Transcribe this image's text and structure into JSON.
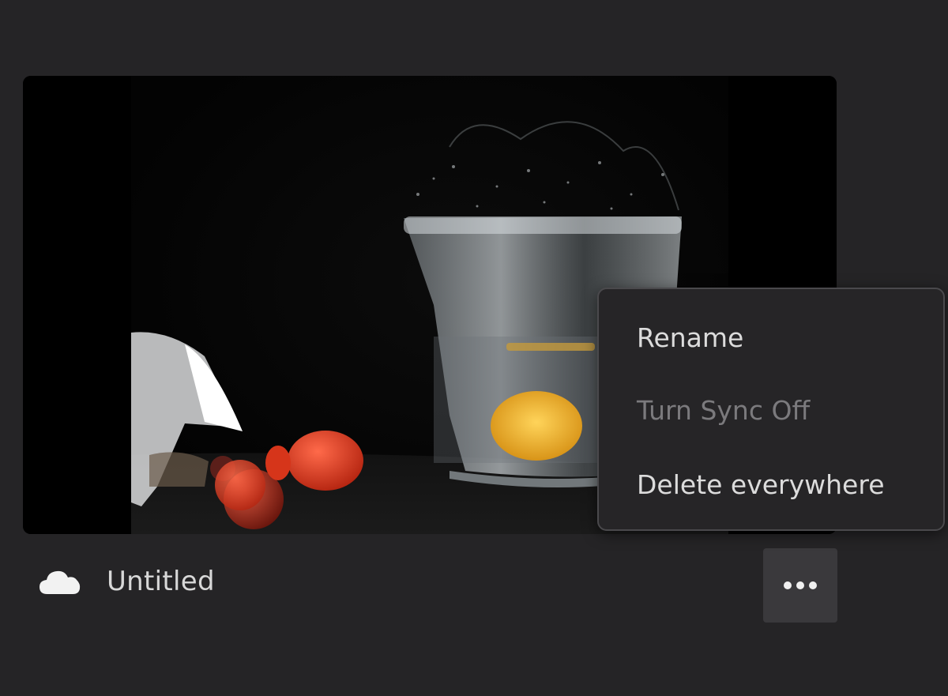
{
  "card": {
    "thumbnail_icon": "photo-thumbnail",
    "title": "Untitled",
    "sync_icon": "cloud-icon",
    "more_icon": "more-horizontal-icon"
  },
  "context_menu": {
    "items": [
      {
        "label": "Rename",
        "enabled": true
      },
      {
        "label": "Turn Sync Off",
        "enabled": false
      },
      {
        "label": "Delete everywhere",
        "enabled": true
      }
    ]
  },
  "colors": {
    "background": "#252426",
    "menu_background": "#262527",
    "menu_border": "#4a494c",
    "text": "#dcdcdc",
    "disabled_text": "#7b7a7d",
    "button_background": "#3a393c"
  }
}
